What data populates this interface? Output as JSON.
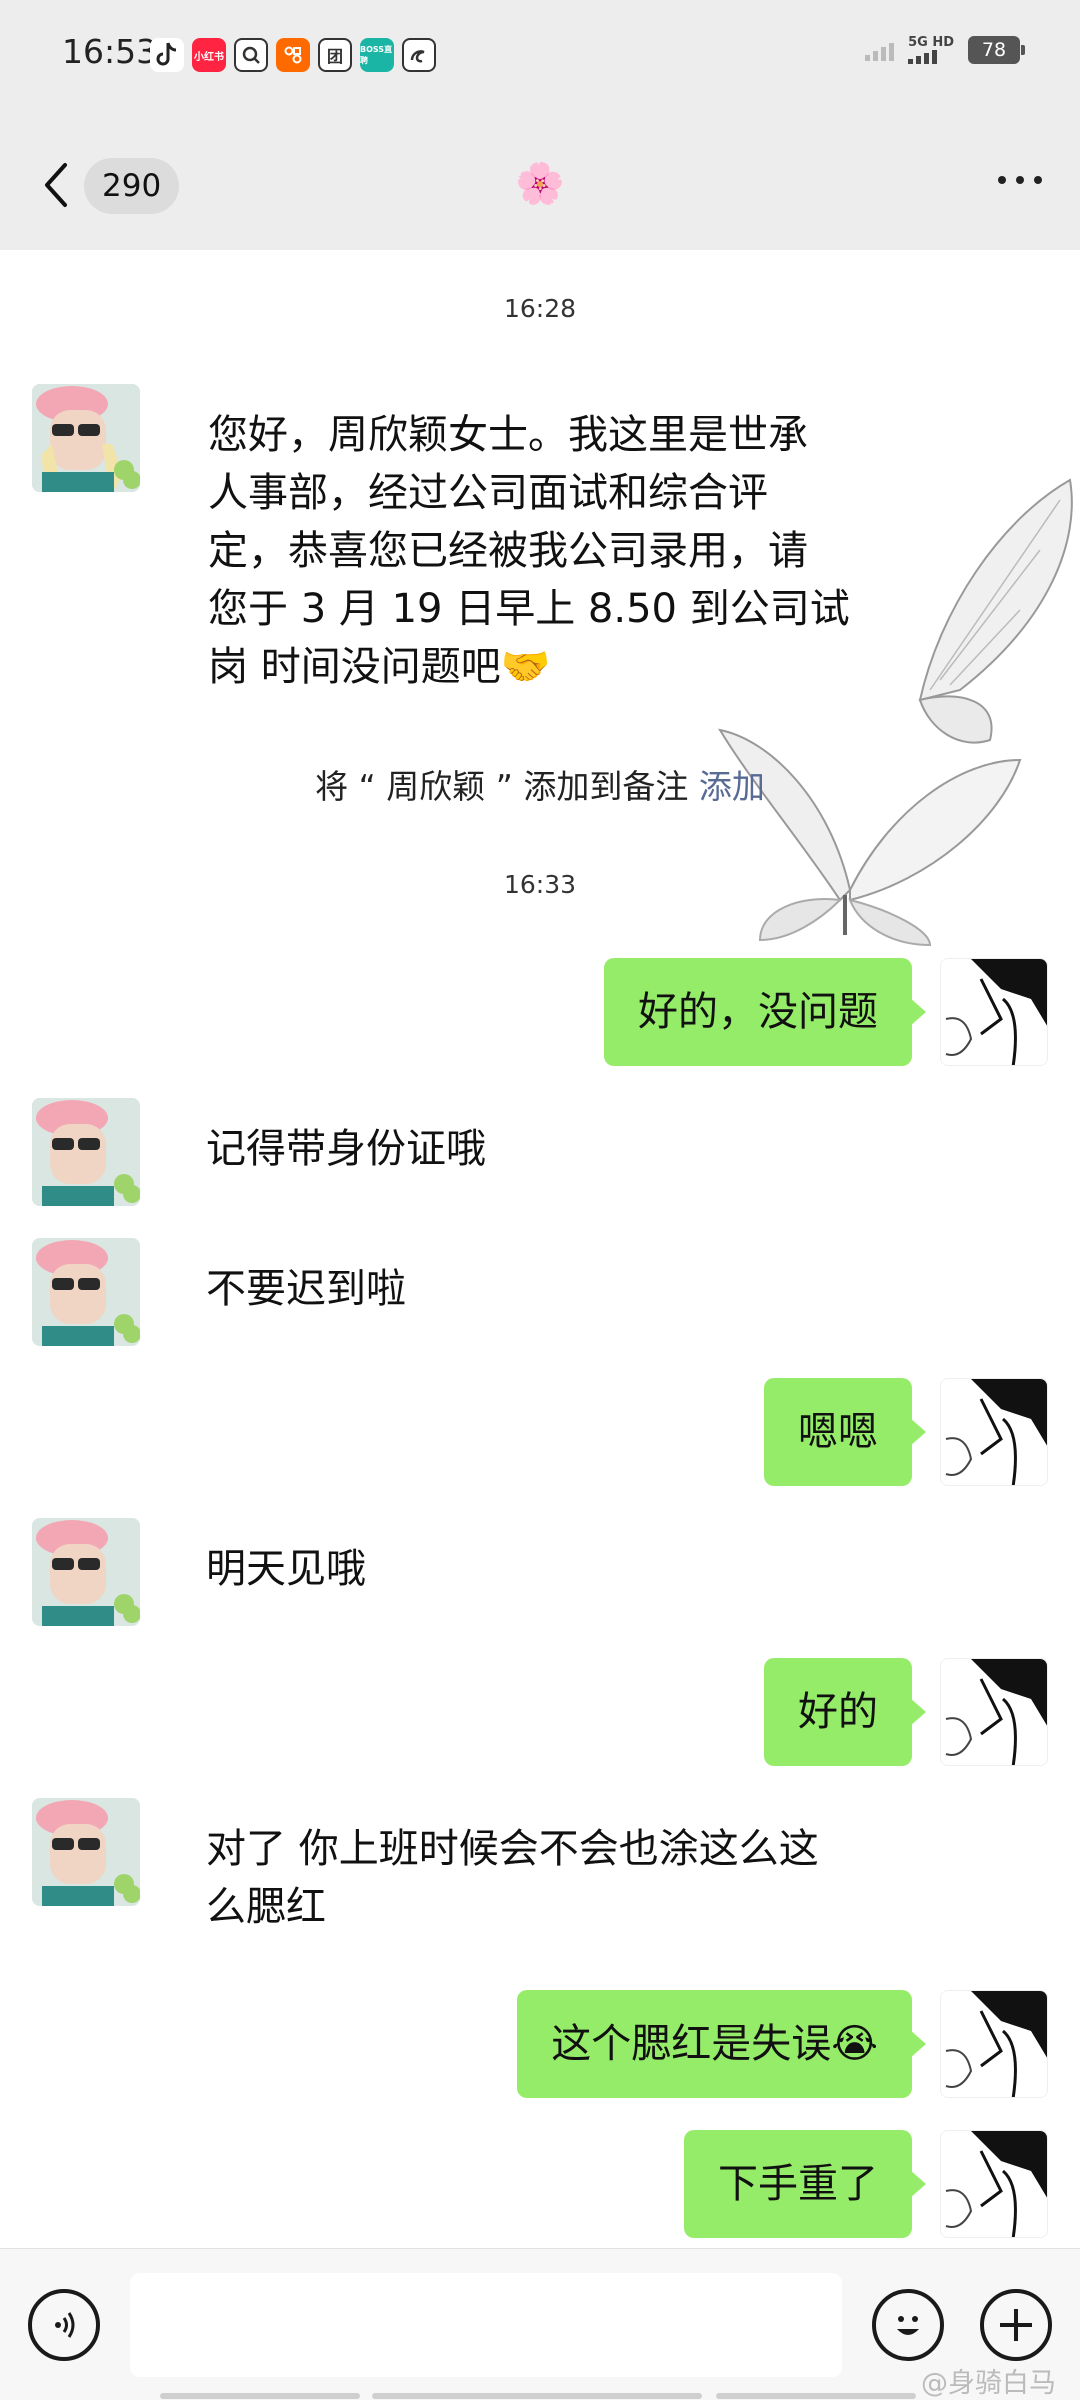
{
  "status_bar": {
    "time": "16:53",
    "network": "5G HD",
    "battery": "78",
    "app_icons": [
      "tiktok-icon",
      "xiaohongshu-icon",
      "search-app-icon",
      "taobao-icon",
      "tuan-icon",
      "boss-icon",
      "uc-icon"
    ],
    "app_labels": [
      "小红书",
      "团",
      "BOSS直聘"
    ]
  },
  "nav": {
    "unread_count": "290",
    "title": "🌸"
  },
  "chat": {
    "timestamps": [
      "16:28",
      "16:33"
    ],
    "system_note": {
      "text": "将 “ 周欣颖 ” 添加到备注 ",
      "link": "添加"
    },
    "messages": [
      {
        "side": "left",
        "text_lines": [
          "您好，周欣颖女士。我这里是世承",
          "人事部，经过公司面试和综合评",
          "定，恭喜您已经被我公司录用，请",
          "您于 3 月 19 日早上 8.50 到公司试",
          "岗 时间没问题吧🤝"
        ]
      },
      {
        "side": "right",
        "text": "好的，没问题"
      },
      {
        "side": "left",
        "text": "记得带身份证哦"
      },
      {
        "side": "left",
        "text": "不要迟到啦"
      },
      {
        "side": "right",
        "text": "嗯嗯"
      },
      {
        "side": "left",
        "text": "明天见哦"
      },
      {
        "side": "right",
        "text": "好的"
      },
      {
        "side": "left",
        "text_lines": [
          "对了 你上班时候会不会也涂这么这",
          "么腮红"
        ]
      },
      {
        "side": "right",
        "text": "这个腮红是失误😭"
      },
      {
        "side": "right",
        "text": "下手重了"
      }
    ]
  },
  "input_bar": {
    "voice_icon": "voice-icon",
    "emoji_icon": "emoji-icon",
    "plus_icon": "plus-icon",
    "watermark": "@身骑白马"
  },
  "colors": {
    "sent_bubble": "#95ec69",
    "link": "#576b95",
    "header_bg": "#ededed"
  }
}
